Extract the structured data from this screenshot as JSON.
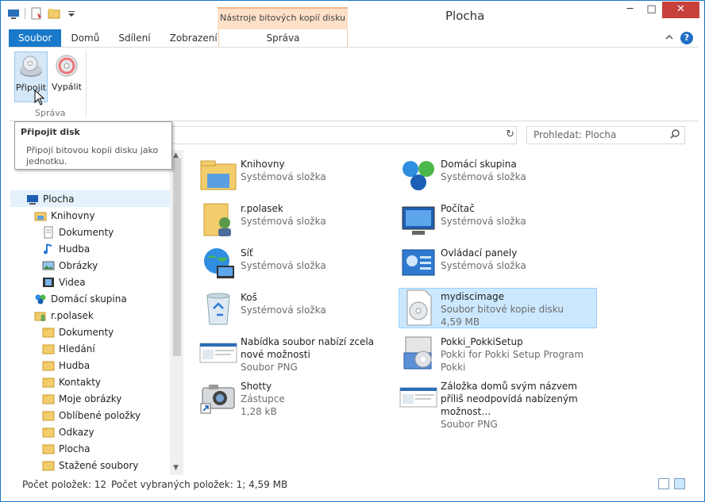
{
  "window": {
    "title": "Plocha",
    "context_tab_header": "Nástroje bitových kopií disku",
    "minimize": "─",
    "maximize": "□",
    "close": "✕"
  },
  "ribbon": {
    "tabs": [
      "Soubor",
      "Domů",
      "Sdílení",
      "Zobrazení"
    ],
    "context_tab": "Správa",
    "buttons": {
      "mount": "Připojit",
      "burn": "Vypálit"
    },
    "group_label": "Správa",
    "help": "?"
  },
  "tooltip": {
    "title": "Připojit disk",
    "body": "Připojí bitovou kopii disku jako jednotku."
  },
  "search": {
    "placeholder": "Prohledat: Plocha"
  },
  "nav": [
    {
      "label": "Plocha",
      "icon": "desktop-icon",
      "level": 0,
      "selected": true
    },
    {
      "label": "Knihovny",
      "icon": "libraries-icon",
      "level": 1
    },
    {
      "label": "Dokumenty",
      "icon": "documents-icon",
      "level": 2
    },
    {
      "label": "Hudba",
      "icon": "music-icon",
      "level": 2
    },
    {
      "label": "Obrázky",
      "icon": "pictures-icon",
      "level": 2
    },
    {
      "label": "Videa",
      "icon": "videos-icon",
      "level": 2
    },
    {
      "label": "Domácí skupina",
      "icon": "homegroup-icon",
      "level": 1
    },
    {
      "label": "r.polasek",
      "icon": "user-folder-icon",
      "level": 1
    },
    {
      "label": "Dokumenty",
      "icon": "folder-icon",
      "level": 2
    },
    {
      "label": "Hledání",
      "icon": "folder-icon",
      "level": 2
    },
    {
      "label": "Hudba",
      "icon": "folder-icon",
      "level": 2
    },
    {
      "label": "Kontakty",
      "icon": "folder-icon",
      "level": 2
    },
    {
      "label": "Moje obrázky",
      "icon": "folder-icon",
      "level": 2
    },
    {
      "label": "Oblíbené položky",
      "icon": "folder-icon",
      "level": 2
    },
    {
      "label": "Odkazy",
      "icon": "folder-icon",
      "level": 2
    },
    {
      "label": "Plocha",
      "icon": "folder-icon",
      "level": 2
    },
    {
      "label": "Stažené soubory",
      "icon": "folder-icon",
      "level": 2
    }
  ],
  "items": [
    {
      "name": "Knihovny",
      "lines": [
        "Systémová složka"
      ],
      "icon": "libraries-icon",
      "col": 0,
      "row": 0
    },
    {
      "name": "Domácí skupina",
      "lines": [
        "Systémová složka"
      ],
      "icon": "homegroup-icon",
      "col": 1,
      "row": 0
    },
    {
      "name": "r.polasek",
      "lines": [
        "Systémová složka"
      ],
      "icon": "user-folder-icon",
      "col": 0,
      "row": 1
    },
    {
      "name": "Počítač",
      "lines": [
        "Systémová složka"
      ],
      "icon": "computer-icon",
      "col": 1,
      "row": 1
    },
    {
      "name": "Síť",
      "lines": [
        "Systémová složka"
      ],
      "icon": "network-icon",
      "col": 0,
      "row": 2
    },
    {
      "name": "Ovládací panely",
      "lines": [
        "Systémová složka"
      ],
      "icon": "control-panel-icon",
      "col": 1,
      "row": 2
    },
    {
      "name": "Koš",
      "lines": [
        "Systémová složka"
      ],
      "icon": "recycle-bin-icon",
      "col": 0,
      "row": 3
    },
    {
      "name": "mydiscimage",
      "lines": [
        "Soubor bitové kopie disku",
        "4,59 MB"
      ],
      "icon": "disc-image-icon",
      "col": 1,
      "row": 3,
      "selected": true
    },
    {
      "name": "Nabídka soubor nabízí zcela nové možnosti",
      "lines": [
        "Soubor PNG"
      ],
      "icon": "png-thumbnail-icon",
      "col": 0,
      "row": 4
    },
    {
      "name": "Pokki_PokkiSetup",
      "lines": [
        "Pokki for Pokki Setup Program",
        "Pokki"
      ],
      "icon": "installer-icon",
      "col": 1,
      "row": 4
    },
    {
      "name": "Shotty",
      "lines": [
        "Zástupce",
        "1,28 kB"
      ],
      "icon": "camera-shortcut-icon",
      "col": 0,
      "row": 5
    },
    {
      "name": "Záložka domů svým názvem příliš neodpovídá nabízeným možnost…",
      "lines": [
        "Soubor PNG"
      ],
      "icon": "png-thumbnail-icon",
      "col": 1,
      "row": 5
    }
  ],
  "status": {
    "count": "Počet položek: 12",
    "selected": "Počet vybraných položek: 1; 4,59 MB"
  },
  "colors": {
    "accent": "#1979ca",
    "selection": "#cce8ff",
    "context_tab": "#fde0c8",
    "close": "#c7423c"
  }
}
